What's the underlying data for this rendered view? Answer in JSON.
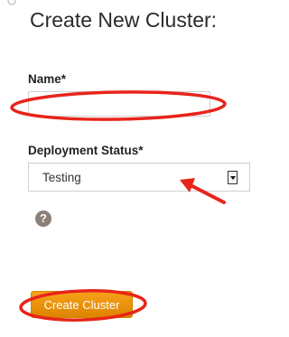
{
  "page": {
    "title": "Create New Cluster:"
  },
  "form": {
    "name_label": "Name*",
    "name_value": "",
    "status_label": "Deployment Status*",
    "status_selected": "Testing",
    "submit_label": "Create Cluster"
  },
  "icons": {
    "help": "help-question-icon",
    "select_arrow": "chevron-down-icon"
  },
  "colors": {
    "button": "#f0961a",
    "annotation": "#e8241a",
    "help_icon": "#8a7f79"
  }
}
